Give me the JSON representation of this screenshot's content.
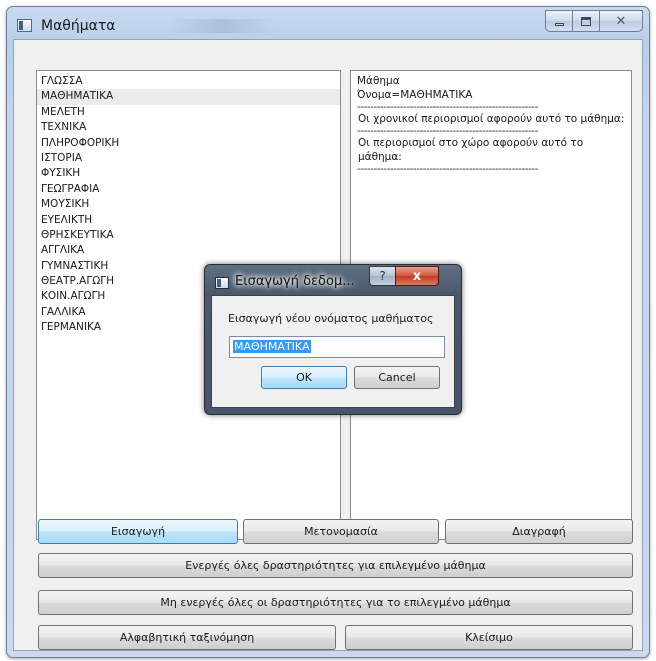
{
  "window": {
    "title": "Μαθήματα"
  },
  "caption": {
    "minimize": "minimize",
    "maximize": "maximize",
    "close": "close"
  },
  "list": {
    "selected_index": 1,
    "items": [
      "ΓΛΩΣΣΑ",
      "ΜΑΘΗΜΑΤΙΚΑ",
      "ΜΕΛΕΤΗ",
      "ΤΕΧΝΙΚΑ",
      "ΠΛΗΡΟΦΟΡΙΚΗ",
      "ΙΣΤΟΡΙΑ",
      "ΦΥΣΙΚΗ",
      "ΓΕΩΓΡΑΦΙΑ",
      "ΜΟΥΣΙΚΗ",
      "ΕΥΕΛΙΚΤΗ",
      "ΘΡΗΣΚΕΥΤΙΚΑ",
      "ΑΓΓΛΙΚΑ",
      "ΓΥΜΝΑΣΤΙΚΗ",
      "ΘΕΑΤΡ.ΑΓΩΓΗ",
      "ΚΟΙΝ.ΑΓΩΓΗ",
      "ΓΑΛΛΙΚΑ",
      "ΓΕΡΜΑΝΙΚΑ"
    ]
  },
  "info": {
    "line1": "Μάθημα",
    "line2": "Όνομα=ΜΑΘΗΜΑΤΙΚΑ",
    "separator": "-------------------------------------------------------",
    "time_constraints": "Οι χρονικοί περιορισμοί αφορούν αυτό το μάθημα:",
    "space_constraints": "Οι περιορισμοί στο χώρο αφορούν αυτό το μάθημα:"
  },
  "buttons": {
    "insert": "Εισαγωγή",
    "rename": "Μετονομασία",
    "delete": "Διαγραφή",
    "activate_all": "Ενεργές όλες δραστηριότητες για επιλεγμένο μάθημα",
    "deactivate_all": "Μη ενεργές όλες οι δραστηριότητες για το επιλεγμένο μάθημα",
    "sort": "Αλφαβητική ταξινόμηση",
    "close": "Κλείσιμο"
  },
  "dialog": {
    "title": "Εισαγωγή δεδομ...",
    "help": "?",
    "close": "x",
    "prompt": "Εισαγωγή νέου ονόματος μαθήματος",
    "value": "ΜΑΘΗΜΑΤΙΚΑ",
    "ok": "OK",
    "cancel": "Cancel"
  }
}
